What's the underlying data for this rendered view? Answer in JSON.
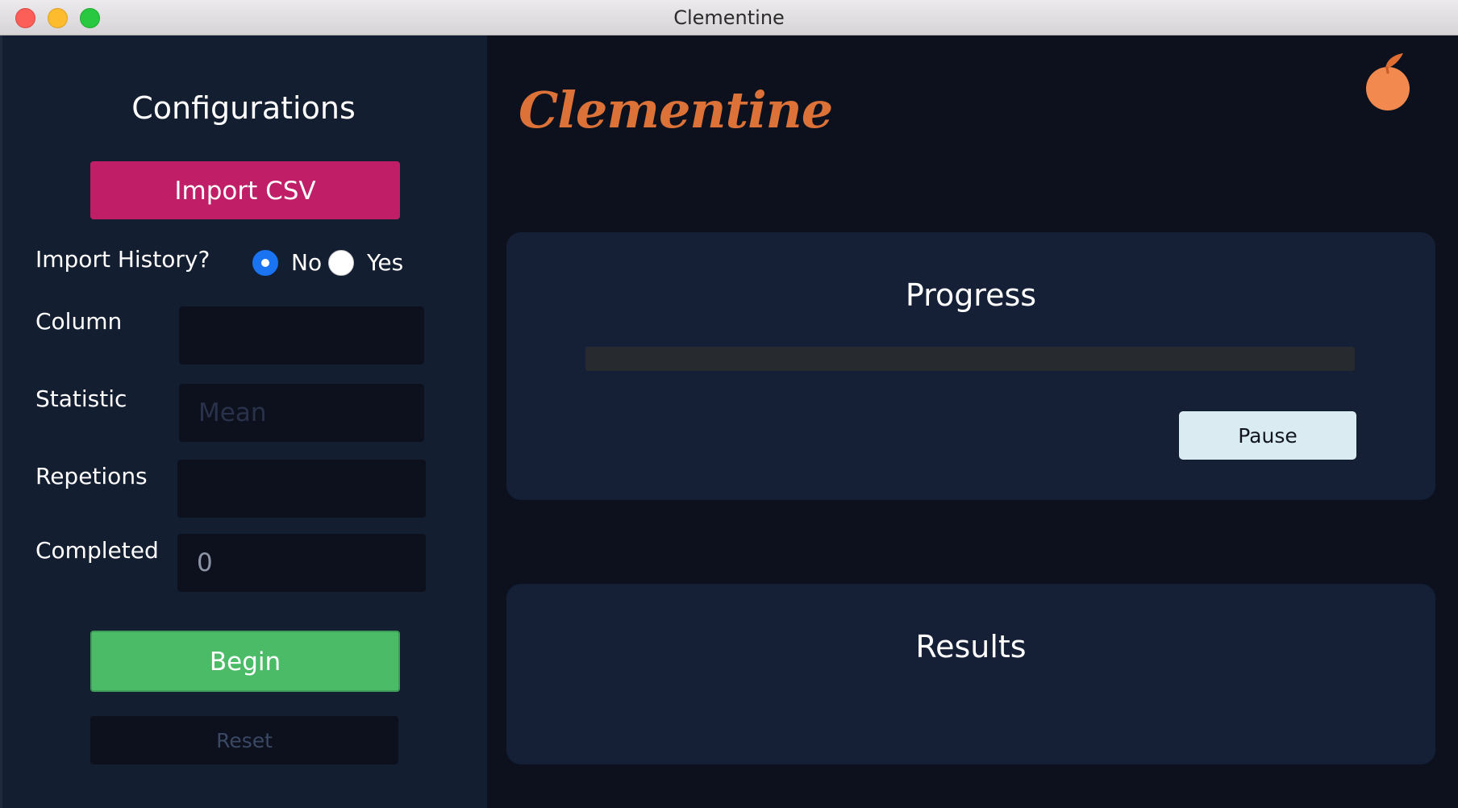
{
  "window": {
    "title": "Clementine"
  },
  "sidebar": {
    "title": "Configurations",
    "import_button_label": "Import CSV",
    "import_history": {
      "label": "Import History?",
      "options": [
        {
          "label": "No",
          "checked": true
        },
        {
          "label": "Yes",
          "checked": false
        }
      ]
    },
    "fields": {
      "column": {
        "label": "Column",
        "value": "",
        "placeholder": ""
      },
      "statistic": {
        "label": "Statistic",
        "value": "",
        "placeholder": "Mean"
      },
      "repetions": {
        "label": "Repetions",
        "value": "",
        "placeholder": ""
      },
      "completed": {
        "label": "Completed",
        "value": "0",
        "placeholder": ""
      }
    },
    "begin_button_label": "Begin",
    "reset_button_label": "Reset"
  },
  "main": {
    "brand": "Clementine",
    "progress": {
      "title": "Progress",
      "value_fraction": 0,
      "pause_button_label": "Pause"
    },
    "results": {
      "title": "Results"
    }
  },
  "colors": {
    "accent_import": "#c01f68",
    "begin_green": "#4cbb68",
    "brand_orange": "#dd7238",
    "radio_blue": "#1a73f0",
    "sidebar_bg": "#141e31",
    "main_bg": "#0c111d",
    "card_bg": "#152036"
  },
  "icons": {
    "app_logo": "clementine-fruit-icon"
  }
}
